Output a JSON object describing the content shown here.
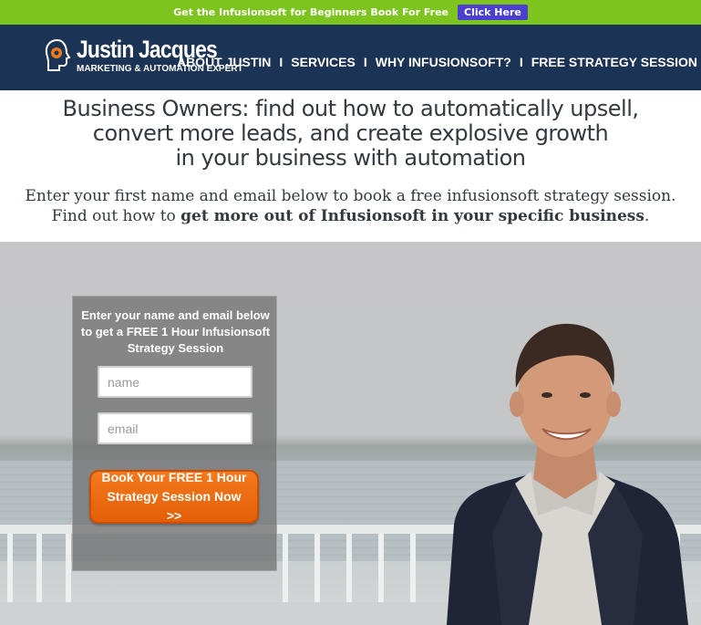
{
  "topbar": {
    "text": "Get the Infusionsoft for Beginners Book For Free",
    "button_label": "Click Here"
  },
  "header": {
    "logo_name": "Justin Jacques",
    "logo_tagline": "MARKETING & AUTOMATION EXPERT",
    "nav": [
      {
        "label": "ABOUT JUSTIN"
      },
      {
        "label": "SERVICES"
      },
      {
        "label": "WHY INFUSIONSOFT?"
      },
      {
        "label": "FREE STRATEGY SESSION"
      }
    ],
    "nav_separator": "I"
  },
  "hero": {
    "headline_lines": [
      "Business Owners: find out how to automatically upsell,",
      "convert more leads, and create explosive growth",
      "in your business with automation"
    ],
    "subtext_line1": "Enter your first name and email below to book a free infusionsoft strategy session.",
    "subtext_line2_prefix": "Find out how to ",
    "subtext_line2_bold": "get more out of Infusionsoft in your specific business",
    "subtext_line2_suffix": "."
  },
  "form": {
    "title": "Enter your name and email below to get a FREE 1 Hour Infusionsoft Strategy Session",
    "name_placeholder": "name",
    "email_placeholder": "email",
    "submit_label": "Book Your FREE 1 Hour Strategy Session Now >>"
  },
  "colors": {
    "topbar_bg": "#7dc41f",
    "header_bg": "#1b3354",
    "cta_orange": "#f47a1c",
    "topbar_button": "#4a3fd0"
  }
}
